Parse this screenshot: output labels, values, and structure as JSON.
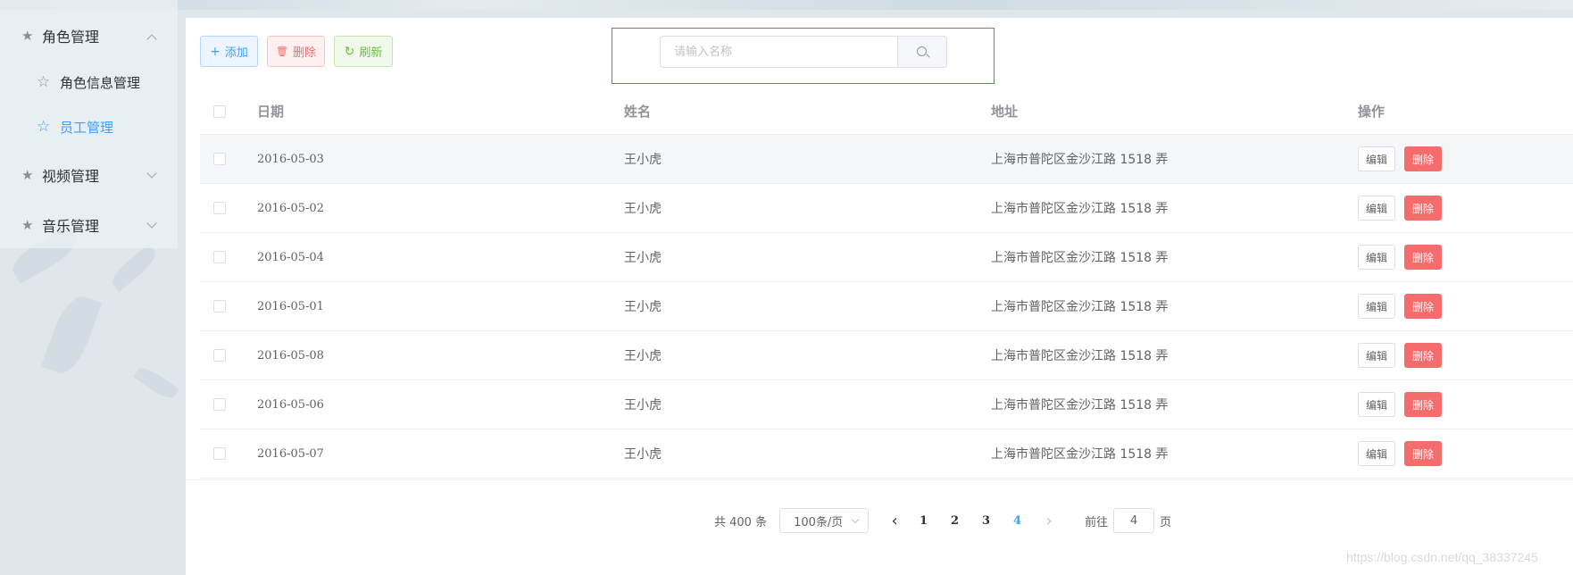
{
  "sidebar": {
    "groups": [
      {
        "label": "角色管理",
        "expanded": true,
        "icon": "star-icon"
      },
      {
        "label": "视频管理",
        "expanded": false,
        "icon": "star-icon"
      },
      {
        "label": "音乐管理",
        "expanded": false,
        "icon": "star-icon"
      }
    ],
    "sub_items": [
      {
        "label": "角色信息管理",
        "active": false,
        "icon": "star-outline-icon"
      },
      {
        "label": "员工管理",
        "active": true,
        "icon": "star-outline-icon"
      }
    ]
  },
  "toolbar": {
    "add_icon": "+",
    "add_label": "添加",
    "delete_icon": "🗑",
    "delete_label": "删除",
    "refresh_icon": "↻",
    "refresh_label": "刷新"
  },
  "search": {
    "placeholder": "请输入名称",
    "value": ""
  },
  "table": {
    "columns": [
      "日期",
      "姓名",
      "地址",
      "操作"
    ],
    "rows": [
      {
        "date": "2016-05-03",
        "name": "王小虎",
        "address": "上海市普陀区金沙江路 1518 弄",
        "edit": "编辑",
        "delete": "删除"
      },
      {
        "date": "2016-05-02",
        "name": "王小虎",
        "address": "上海市普陀区金沙江路 1518 弄",
        "edit": "编辑",
        "delete": "删除"
      },
      {
        "date": "2016-05-04",
        "name": "王小虎",
        "address": "上海市普陀区金沙江路 1518 弄",
        "edit": "编辑",
        "delete": "删除"
      },
      {
        "date": "2016-05-01",
        "name": "王小虎",
        "address": "上海市普陀区金沙江路 1518 弄",
        "edit": "编辑",
        "delete": "删除"
      },
      {
        "date": "2016-05-08",
        "name": "王小虎",
        "address": "上海市普陀区金沙江路 1518 弄",
        "edit": "编辑",
        "delete": "删除"
      },
      {
        "date": "2016-05-06",
        "name": "王小虎",
        "address": "上海市普陀区金沙江路 1518 弄",
        "edit": "编辑",
        "delete": "删除"
      },
      {
        "date": "2016-05-07",
        "name": "王小虎",
        "address": "上海市普陀区金沙江路 1518 弄",
        "edit": "编辑",
        "delete": "删除"
      }
    ]
  },
  "pagination": {
    "total_label": "共 400 条",
    "page_size": "100条/页",
    "pages": [
      "1",
      "2",
      "3",
      "4"
    ],
    "current_page": "4",
    "goto_label": "前往",
    "goto_value": "4",
    "page_suffix": "页"
  },
  "watermark": "https://blog.csdn.net/qq_38337245",
  "colors": {
    "primary": "#409eff",
    "danger": "#f56c6c",
    "success": "#67c23a",
    "highlight_border": "#e84b4b"
  }
}
